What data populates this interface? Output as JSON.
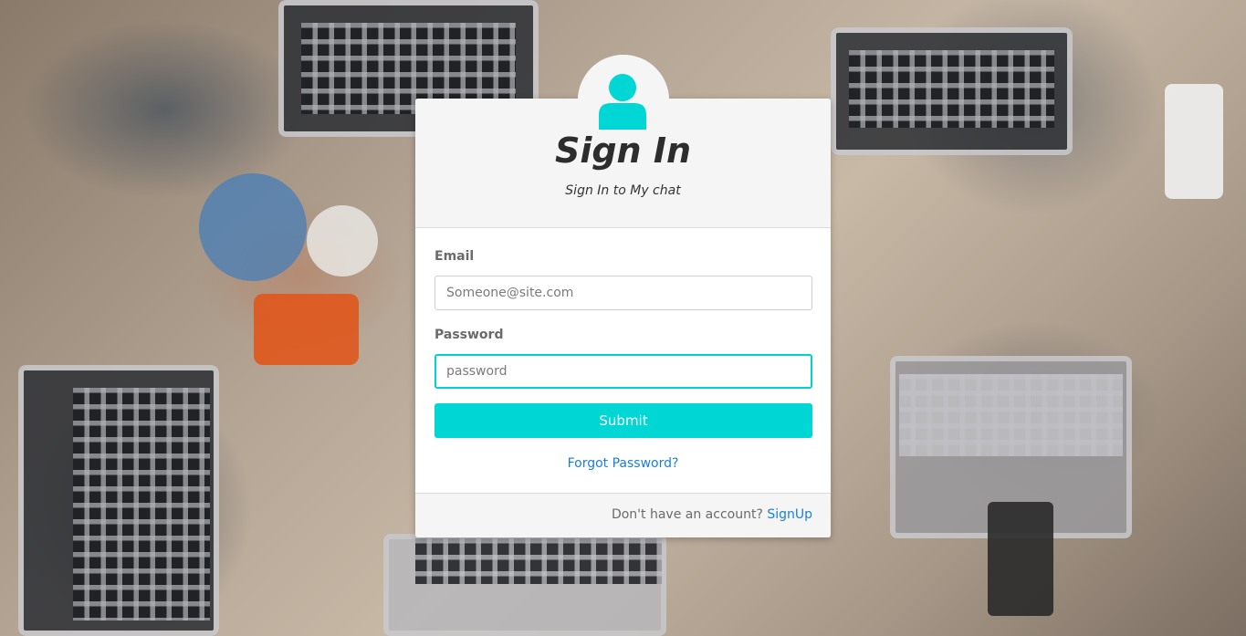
{
  "background": {
    "description_icon": "desk-workspace-photo"
  },
  "signin": {
    "title": "Sign In",
    "subtitle": "Sign In to My chat",
    "avatar_icon": "user-icon",
    "accent_color": "#00d6d4"
  },
  "form": {
    "email_label": "Email",
    "email_placeholder": "Someone@site.com",
    "email_value": "",
    "password_label": "Password",
    "password_placeholder": "password",
    "password_value": "",
    "submit_label": "Submit",
    "forgot_label": "Forgot Password?"
  },
  "footer": {
    "prompt": "Don't have an account?",
    "signup_label": "SignUp"
  }
}
